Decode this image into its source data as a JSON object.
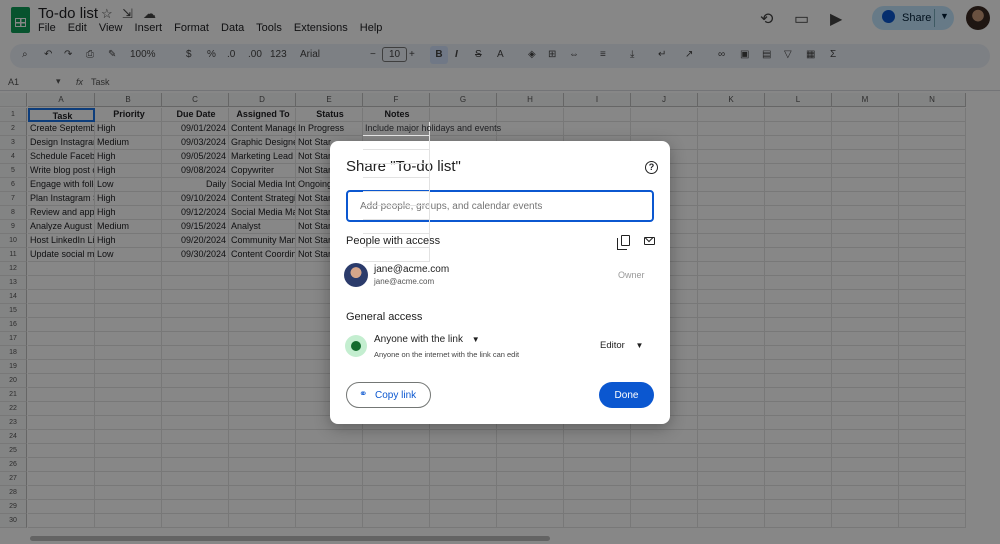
{
  "app": {
    "title": "To-do list",
    "menus": [
      "File",
      "Edit",
      "View",
      "Insert",
      "Format",
      "Data",
      "Tools",
      "Extensions",
      "Help"
    ],
    "share_label": "Share"
  },
  "toolbar": {
    "zoom": "100%",
    "currency": "$",
    "percent": "%",
    "dec_decrease": ".0",
    "dec_increase": ".00",
    "number_format": "123",
    "font": "Arial",
    "font_size": "10"
  },
  "formula_bar": {
    "cell_ref": "A1",
    "fx": "fx",
    "content": "Task"
  },
  "sheet": {
    "columns": [
      "A",
      "B",
      "C",
      "D",
      "E",
      "F",
      "G",
      "H",
      "I",
      "J",
      "K",
      "L",
      "M",
      "N"
    ],
    "rows": [
      "1",
      "2",
      "3",
      "4",
      "5",
      "6",
      "7",
      "8",
      "9",
      "10",
      "11",
      "12",
      "13",
      "14",
      "15",
      "16",
      "17",
      "18",
      "19",
      "20",
      "21",
      "22",
      "23",
      "24",
      "25",
      "26",
      "27",
      "28",
      "29",
      "30"
    ],
    "header": [
      "Task",
      "Priority",
      "Due Date",
      "Assigned To",
      "Status",
      "Notes"
    ],
    "data": [
      [
        "Create Septemb",
        "High",
        "09/01/2024",
        "Content Manage",
        "In Progress",
        "Include major holidays and events"
      ],
      [
        "Design Instagrar",
        "Medium",
        "09/03/2024",
        "Graphic Designe",
        "Not Star",
        ""
      ],
      [
        "Schedule Faceb",
        "High",
        "09/05/2024",
        "Marketing Lead",
        "Not Star",
        ""
      ],
      [
        "Write blog post c",
        "High",
        "09/08/2024",
        "Copywriter",
        "Not Star",
        ""
      ],
      [
        "Engage with follc",
        "Low",
        "Daily",
        "Social Media Inte",
        "Ongoing",
        ""
      ],
      [
        "Plan Instagram S",
        "High",
        "09/10/2024",
        "Content Strategi",
        "Not Star",
        ""
      ],
      [
        "Review and appr",
        "High",
        "09/12/2024",
        "Social Media Ma",
        "Not Star",
        ""
      ],
      [
        "Analyze August",
        "Medium",
        "09/15/2024",
        "Analyst",
        "Not Star",
        ""
      ],
      [
        "Host LinkedIn Li",
        "High",
        "09/20/2024",
        "Community Man",
        "Not Star",
        ""
      ],
      [
        "Update social me",
        "Low",
        "09/30/2024",
        "Content Coordin",
        "Not Star",
        ""
      ]
    ]
  },
  "dialog": {
    "title": "Share \"To-do list\"",
    "input_placeholder": "Add people, groups, and calendar events",
    "people_heading": "People with access",
    "user_name": "jane@acme.com",
    "user_email": "jane@acme.com",
    "user_role": "Owner",
    "general_heading": "General access",
    "access_label": "Anyone with the link",
    "access_desc": "Anyone on the internet with the link can edit",
    "role_label": "Editor",
    "copy_label": "Copy link",
    "done_label": "Done"
  },
  "colors": {
    "accent": "#0b57d0",
    "sheets_green": "#0f9d58",
    "share_bg": "#c2e7ff"
  }
}
